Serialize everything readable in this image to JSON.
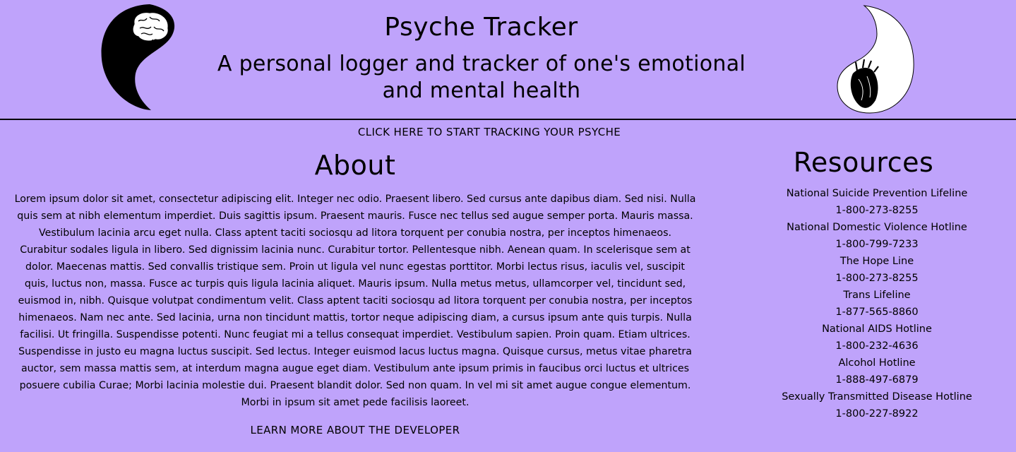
{
  "header": {
    "title": "Psyche Tracker",
    "subtitle": "A personal logger and tracker of one's emotional and mental health"
  },
  "cta": {
    "label": "CLICK HERE TO START TRACKING YOUR PSYCHE"
  },
  "about": {
    "heading": "About",
    "body": "Lorem ipsum dolor sit amet, consectetur adipiscing elit. Integer nec odio. Praesent libero. Sed cursus ante dapibus diam. Sed nisi. Nulla quis sem at nibh elementum imperdiet. Duis sagittis ipsum. Praesent mauris. Fusce nec tellus sed augue semper porta. Mauris massa. Vestibulum lacinia arcu eget nulla. Class aptent taciti sociosqu ad litora torquent per conubia nostra, per inceptos himenaeos. Curabitur sodales ligula in libero. Sed dignissim lacinia nunc. Curabitur tortor. Pellentesque nibh. Aenean quam. In scelerisque sem at dolor. Maecenas mattis. Sed convallis tristique sem. Proin ut ligula vel nunc egestas porttitor. Morbi lectus risus, iaculis vel, suscipit quis, luctus non, massa. Fusce ac turpis quis ligula lacinia aliquet. Mauris ipsum. Nulla metus metus, ullamcorper vel, tincidunt sed, euismod in, nibh. Quisque volutpat condimentum velit. Class aptent taciti sociosqu ad litora torquent per conubia nostra, per inceptos himenaeos. Nam nec ante. Sed lacinia, urna non tincidunt mattis, tortor neque adipiscing diam, a cursus ipsum ante quis turpis. Nulla facilisi. Ut fringilla. Suspendisse potenti. Nunc feugiat mi a tellus consequat imperdiet. Vestibulum sapien. Proin quam. Etiam ultrices. Suspendisse in justo eu magna luctus suscipit. Sed lectus. Integer euismod lacus luctus magna. Quisque cursus, metus vitae pharetra auctor, sem massa mattis sem, at interdum magna augue eget diam. Vestibulum ante ipsum primis in faucibus orci luctus et ultrices posuere cubilia Curae; Morbi lacinia molestie dui. Praesent blandit dolor. Sed non quam. In vel mi sit amet augue congue elementum. Morbi in ipsum sit amet pede facilisis laoreet.",
    "learn_more": "LEARN MORE ABOUT THE DEVELOPER"
  },
  "resources": {
    "heading": "Resources",
    "items": [
      {
        "name": "National Suicide Prevention Lifeline",
        "phone": "1-800-273-8255"
      },
      {
        "name": "National Domestic Violence Hotline",
        "phone": "1-800-799-7233"
      },
      {
        "name": "The Hope Line",
        "phone": "1-800-273-8255"
      },
      {
        "name": "Trans Lifeline",
        "phone": "1-877-565-8860"
      },
      {
        "name": "National AIDS Hotline",
        "phone": "1-800-232-4636"
      },
      {
        "name": "Alcohol Hotline",
        "phone": "1-888-497-6879"
      },
      {
        "name": "Sexually Transmitted Disease Hotline",
        "phone": "1-800-227-8922"
      }
    ]
  },
  "icons": {
    "left": "yin-brain-icon",
    "right": "yang-heart-icon"
  },
  "colors": {
    "background": "#bfa3fb",
    "text": "#000000"
  }
}
